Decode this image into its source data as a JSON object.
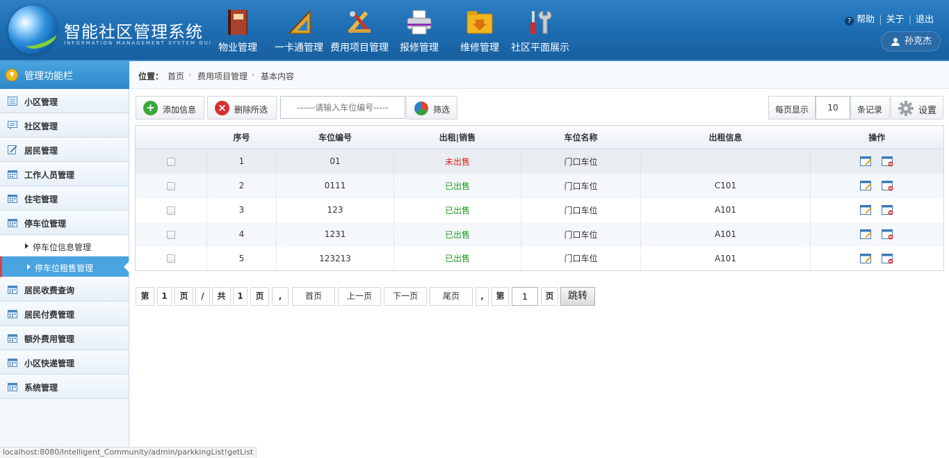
{
  "header": {
    "title": "智能社区管理系统",
    "subtitle": "INFORMATION MANAGEMENT SYSTEM GUI",
    "nav": [
      {
        "label": "物业管理",
        "icon": "book-icon"
      },
      {
        "label": "一卡通管理",
        "icon": "ruler-icon"
      },
      {
        "label": "费用项目管理",
        "icon": "tools-icon"
      },
      {
        "label": "报修管理",
        "icon": "printer-icon"
      },
      {
        "label": "维修管理",
        "icon": "folder-icon"
      },
      {
        "label": "社区平面展示",
        "icon": "screwdriver-wrench-icon"
      }
    ],
    "help": "帮助",
    "about": "关于",
    "logout": "退出",
    "user": "孙克杰"
  },
  "sidebar": {
    "title": "管理功能栏",
    "items": [
      {
        "label": "小区管理"
      },
      {
        "label": "社区管理"
      },
      {
        "label": "居民管理"
      },
      {
        "label": "工作人员管理"
      },
      {
        "label": "住宅管理"
      },
      {
        "label": "停车位管理"
      }
    ],
    "subitems": [
      {
        "label": "停车位信息管理"
      },
      {
        "label": "停车位租售管理"
      }
    ],
    "items_after": [
      {
        "label": "居民收费查询"
      },
      {
        "label": "居民付费管理"
      },
      {
        "label": "额外费用管理"
      },
      {
        "label": "小区快递管理"
      },
      {
        "label": "系统管理"
      }
    ]
  },
  "breadcrumb": {
    "label": "位置：",
    "items": [
      "首页",
      "费用项目管理",
      "基本内容"
    ]
  },
  "toolbar": {
    "add": "添加信息",
    "delete": "删除所选",
    "search_placeholder": "------请输入车位编号-----",
    "filter": "筛选",
    "per_page_label": "每页显示",
    "per_page_value": "10",
    "records_label": "条记录",
    "settings": "设置"
  },
  "table": {
    "headers": [
      "",
      "序号",
      "车位编号",
      "出租|销售",
      "车位名称",
      "出租信息",
      "操作"
    ],
    "rows": [
      {
        "no": "1",
        "code": "01",
        "status": "未出售",
        "status_color": "#e02020",
        "name": "门口车位",
        "rent": ""
      },
      {
        "no": "2",
        "code": "0111",
        "status": "已出售",
        "status_color": "#1f9a1f",
        "name": "门口车位",
        "rent": "C101"
      },
      {
        "no": "3",
        "code": "123",
        "status": "已出售",
        "status_color": "#1f9a1f",
        "name": "门口车位",
        "rent": "A101"
      },
      {
        "no": "4",
        "code": "1231",
        "status": "已出售",
        "status_color": "#1f9a1f",
        "name": "门口车位",
        "rent": "A101"
      },
      {
        "no": "5",
        "code": "123213",
        "status": "已出售",
        "status_color": "#1f9a1f",
        "name": "门口车位",
        "rent": "A101"
      }
    ]
  },
  "pager": {
    "di": "第",
    "cur": "1",
    "ye": "页",
    "slash": "/",
    "gong": "共",
    "total": "1",
    "ye2": "页",
    "comma": ",",
    "first": "首页",
    "prev": "上一页",
    "next": "下一页",
    "last": "尾页",
    "comma2": ",",
    "di2": "第",
    "jump_value": "1",
    "ye3": "页",
    "go": "跳转"
  },
  "status_bar": "localhost:8080/Intelligent_Community/admin/parkkingList!getList"
}
